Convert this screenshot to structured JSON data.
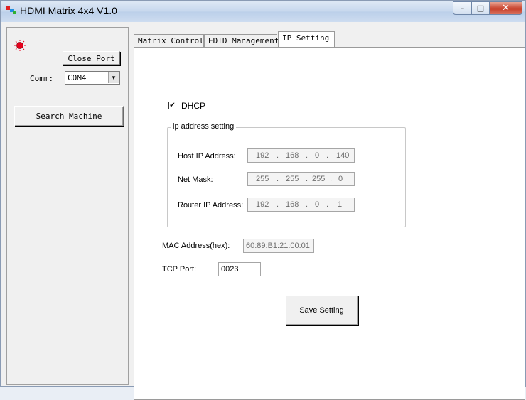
{
  "window": {
    "title": "HDMI Matrix 4x4 V1.0",
    "caption_buttons": {
      "minimize": "–",
      "maximize": "□",
      "close": "✕"
    }
  },
  "left_panel": {
    "status_indicator": {
      "icon": "red-led-icon",
      "color": "#e8001c"
    },
    "close_port_label": "Close Port",
    "comm_label": "Comm:",
    "comm_value": "COM4",
    "search_label": "Search Machine"
  },
  "tabs": [
    {
      "label": "Matrix Control",
      "active": false
    },
    {
      "label": "EDID Management",
      "active": false
    },
    {
      "label": "IP Setting",
      "active": true
    }
  ],
  "ip_setting": {
    "dhcp_label": "DHCP",
    "dhcp_checked": true,
    "dhcp_check_glyph": "✔",
    "group_title": "ip address setting",
    "host_ip": {
      "label": "Host IP Address:",
      "octets": [
        "192",
        "168",
        "0",
        "140"
      ]
    },
    "net_mask": {
      "label": "Net Mask:",
      "octets": [
        "255",
        "255",
        "255",
        "0"
      ]
    },
    "router_ip": {
      "label": "Router IP Address:",
      "octets": [
        "192",
        "168",
        "0",
        "1"
      ]
    },
    "dot": ".",
    "mac_label": "MAC Address(hex):",
    "mac_value": "60:89:B1:21:00:01",
    "tcp_port_label": "TCP Port:",
    "tcp_port_value": "0023",
    "save_label": "Save Setting"
  }
}
